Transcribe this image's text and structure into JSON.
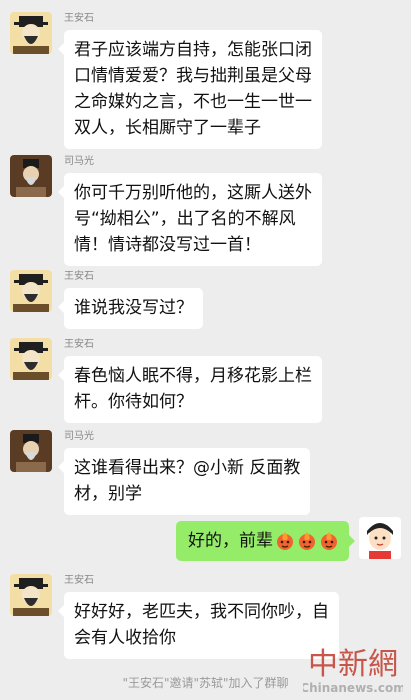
{
  "messages": [
    {
      "sender": "王安石",
      "text": "君子应该端方自持，怎能张口闭\n口情情爱爱？我与拙荆虽是父母\n之命媒妁之言，不也一生一世一\n双人，长相厮守了一辈子"
    },
    {
      "sender": "司马光",
      "text": "你可千万别听他的，这厮人送外\n号“拗相公”，出了名的不解风\n情！情诗都没写过一首！"
    },
    {
      "sender": "王安石",
      "text": "谁说我没写过？"
    },
    {
      "sender": "王安石",
      "text": "春色恼人眠不得，月移花影上栏\n杆。你待如何？"
    },
    {
      "sender": "司马光",
      "text": "这谁看得出来？@小新 反面教\n材，别学"
    },
    {
      "sender": "王安石",
      "text": "好好好，老匹夫，我不同你吵，自\n会有人收拾你"
    }
  ],
  "me": {
    "text": "好的，前辈",
    "emoji": [
      "fire-face-icon",
      "fire-face-icon",
      "fire-face-icon"
    ]
  },
  "system_notice": "\"王安石\"邀请\"苏轼\"加入了群聊",
  "watermark": {
    "cn": "中新網",
    "en": "Chinanews.com"
  },
  "colors": {
    "background": "#ededed",
    "my_bubble": "#95ec69",
    "bubble": "#ffffff",
    "watermark": "#c0392b"
  }
}
